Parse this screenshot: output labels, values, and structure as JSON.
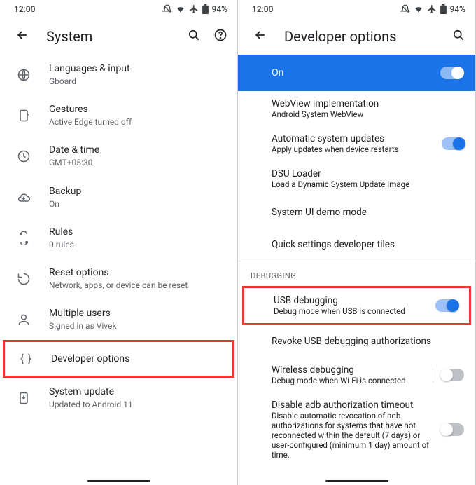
{
  "status": {
    "time": "12:00",
    "battery": "94%"
  },
  "left": {
    "title": "System",
    "items": [
      {
        "icon": "globe",
        "title": "Languages & input",
        "sub": "Gboard"
      },
      {
        "icon": "gesture",
        "title": "Gestures",
        "sub": "Active Edge turned off"
      },
      {
        "icon": "clock",
        "title": "Date & time",
        "sub": "GMT+05:30"
      },
      {
        "icon": "cloud",
        "title": "Backup",
        "sub": "On"
      },
      {
        "icon": "rules",
        "title": "Rules",
        "sub": "0 rules"
      },
      {
        "icon": "reset",
        "title": "Reset options",
        "sub": "Network, apps, or device can be reset"
      },
      {
        "icon": "users",
        "title": "Multiple users",
        "sub": "Signed in as Vivek"
      },
      {
        "icon": "braces",
        "title": "Developer options",
        "sub": ""
      },
      {
        "icon": "update",
        "title": "System update",
        "sub": "Updated to Android 11"
      }
    ]
  },
  "right": {
    "title": "Developer options",
    "master": "On",
    "items_top": [
      {
        "title": "WebView implementation",
        "sub": "Android System WebView",
        "toggle": null
      },
      {
        "title": "Automatic system updates",
        "sub": "Apply updates when device restarts",
        "toggle": true
      },
      {
        "title": "DSU Loader",
        "sub": "Load a Dynamic System Update Image",
        "toggle": null
      },
      {
        "title": "System UI demo mode",
        "sub": "",
        "toggle": null
      },
      {
        "title": "Quick settings developer tiles",
        "sub": "",
        "toggle": null
      }
    ],
    "section": "DEBUGGING",
    "items_debug": [
      {
        "title": "USB debugging",
        "sub": "Debug mode when USB is connected",
        "toggle": true,
        "highlight": true
      },
      {
        "title": "Revoke USB debugging authorizations",
        "sub": "",
        "toggle": null
      },
      {
        "title": "Wireless debugging",
        "sub": "Debug mode when Wi-Fi is connected",
        "toggle": false,
        "div": true
      },
      {
        "title": "Disable adb authorization timeout",
        "sub": "Disable automatic revocation of adb authorizations for systems that have not reconnected within the default (7 days) or user-configured (minimum 1 day) amount of time.",
        "toggle": false
      }
    ]
  }
}
